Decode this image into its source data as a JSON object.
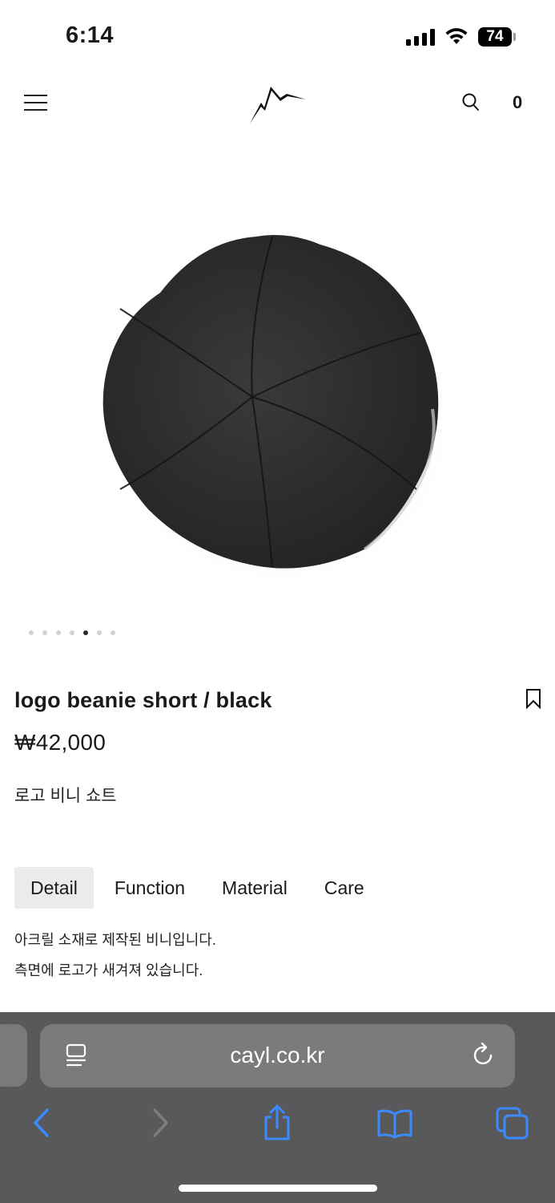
{
  "status_bar": {
    "time": "6:14",
    "battery": "74"
  },
  "header": {
    "menu_icon": "hamburger-menu-icon",
    "logo_icon": "mountain-logo-icon",
    "search_icon": "search-icon",
    "cart_count": "0"
  },
  "product": {
    "image": "black-beanie-top-view",
    "carousel": {
      "total": 7,
      "active_index": 4
    },
    "title": "logo beanie short / black",
    "price": "₩42,000",
    "subtitle": "로고 비니 쇼트"
  },
  "tabs": [
    {
      "label": "Detail",
      "active": true
    },
    {
      "label": "Function",
      "active": false
    },
    {
      "label": "Material",
      "active": false
    },
    {
      "label": "Care",
      "active": false
    }
  ],
  "detail": {
    "line1": "아크릴 소재로 제작된 비니입니다.",
    "line2": "측면에 로고가 새겨져 있습니다."
  },
  "browser": {
    "url": "cayl.co.kr",
    "accent_color": "#3a8bff",
    "icons": [
      "reader-icon",
      "reload-icon",
      "back-icon",
      "forward-icon",
      "share-icon",
      "bookmarks-icon",
      "tabs-icon"
    ]
  }
}
